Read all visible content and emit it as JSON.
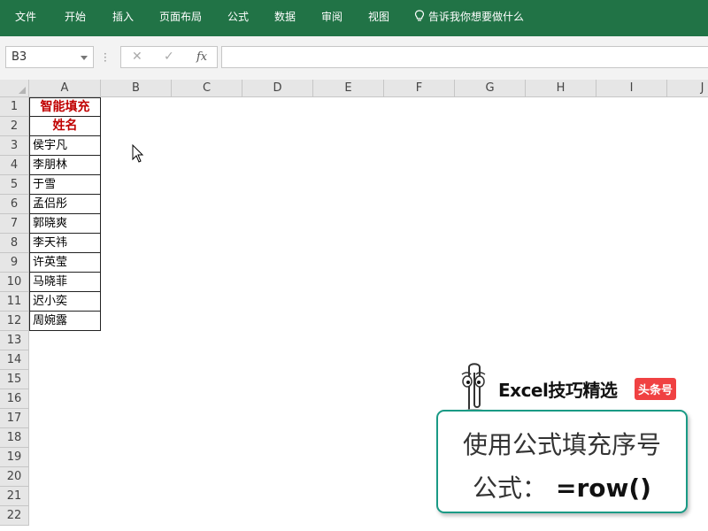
{
  "ribbon": {
    "tabs": [
      "文件",
      "开始",
      "插入",
      "页面布局",
      "公式",
      "数据",
      "审阅",
      "视图"
    ],
    "tell_me": "告诉我你想要做什么"
  },
  "formula_bar": {
    "name_box": "B3",
    "cancel_icon": "✕",
    "enter_icon": "✓",
    "fx_label": "fx",
    "content": ""
  },
  "sheet": {
    "columns": [
      "A",
      "B",
      "C",
      "D",
      "E",
      "F",
      "G",
      "H",
      "I",
      "J"
    ],
    "rows": [
      "1",
      "2",
      "3",
      "4",
      "5",
      "6",
      "7",
      "8",
      "9",
      "10",
      "11",
      "12",
      "13",
      "14",
      "15",
      "16",
      "17",
      "18",
      "19",
      "20",
      "21",
      "22"
    ],
    "column_a": [
      "智能填充",
      "姓名",
      "侯宇凡",
      "李朋林",
      "于雪",
      "孟侣彤",
      "郭晓爽",
      "李天祎",
      "许英莹",
      "马晓菲",
      "迟小奕",
      "周婉露"
    ]
  },
  "brand": {
    "name": "Excel技巧精选",
    "badge": "头条号"
  },
  "tip": {
    "line1": "使用公式填充序号",
    "line2_label": "公式：",
    "formula": "=row()"
  },
  "colors": {
    "ribbon": "#217346",
    "header_text": "#c00000",
    "tip_border": "#1a9a85",
    "badge": "#f04142"
  }
}
